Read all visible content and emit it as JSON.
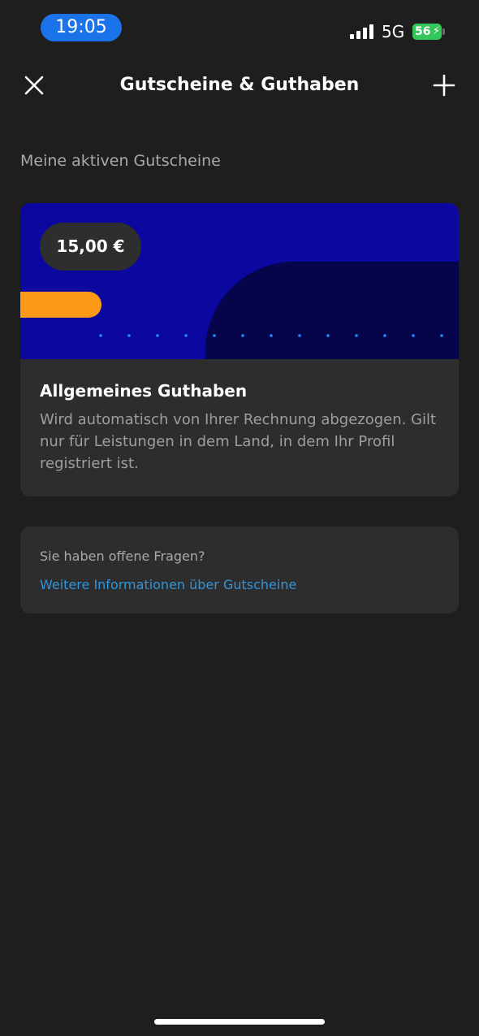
{
  "status_bar": {
    "time": "19:05",
    "network": "5G",
    "battery": "56",
    "icons": [
      "signal-icon",
      "bolt-icon"
    ]
  },
  "header": {
    "title": "Gutscheine & Guthaben",
    "left_icon": "close-icon",
    "right_icon": "plus-icon"
  },
  "section": {
    "label": "Meine aktiven Gutscheine"
  },
  "voucher": {
    "amount": "15,00 €",
    "title": "Allgemeines Guthaben",
    "description": "Wird automatisch von Ihrer Rechnung abgezogen. Gilt nur für Leistungen in dem Land, in dem Ihr Profil registriert ist.",
    "colors": {
      "banner": "#0b079f",
      "banner_shape": "#06044a",
      "accent_bar": "#ff9a17",
      "dots": "#1e8fff"
    }
  },
  "info": {
    "question": "Sie haben offene Fragen?",
    "link": "Weitere Informationen über Gutscheine",
    "link_color": "#2f95dc"
  },
  "theme": {
    "background": "#1e1e1e",
    "card": "#2d2d2d",
    "time_pill": "#1a73e8",
    "battery": "#34c759"
  }
}
